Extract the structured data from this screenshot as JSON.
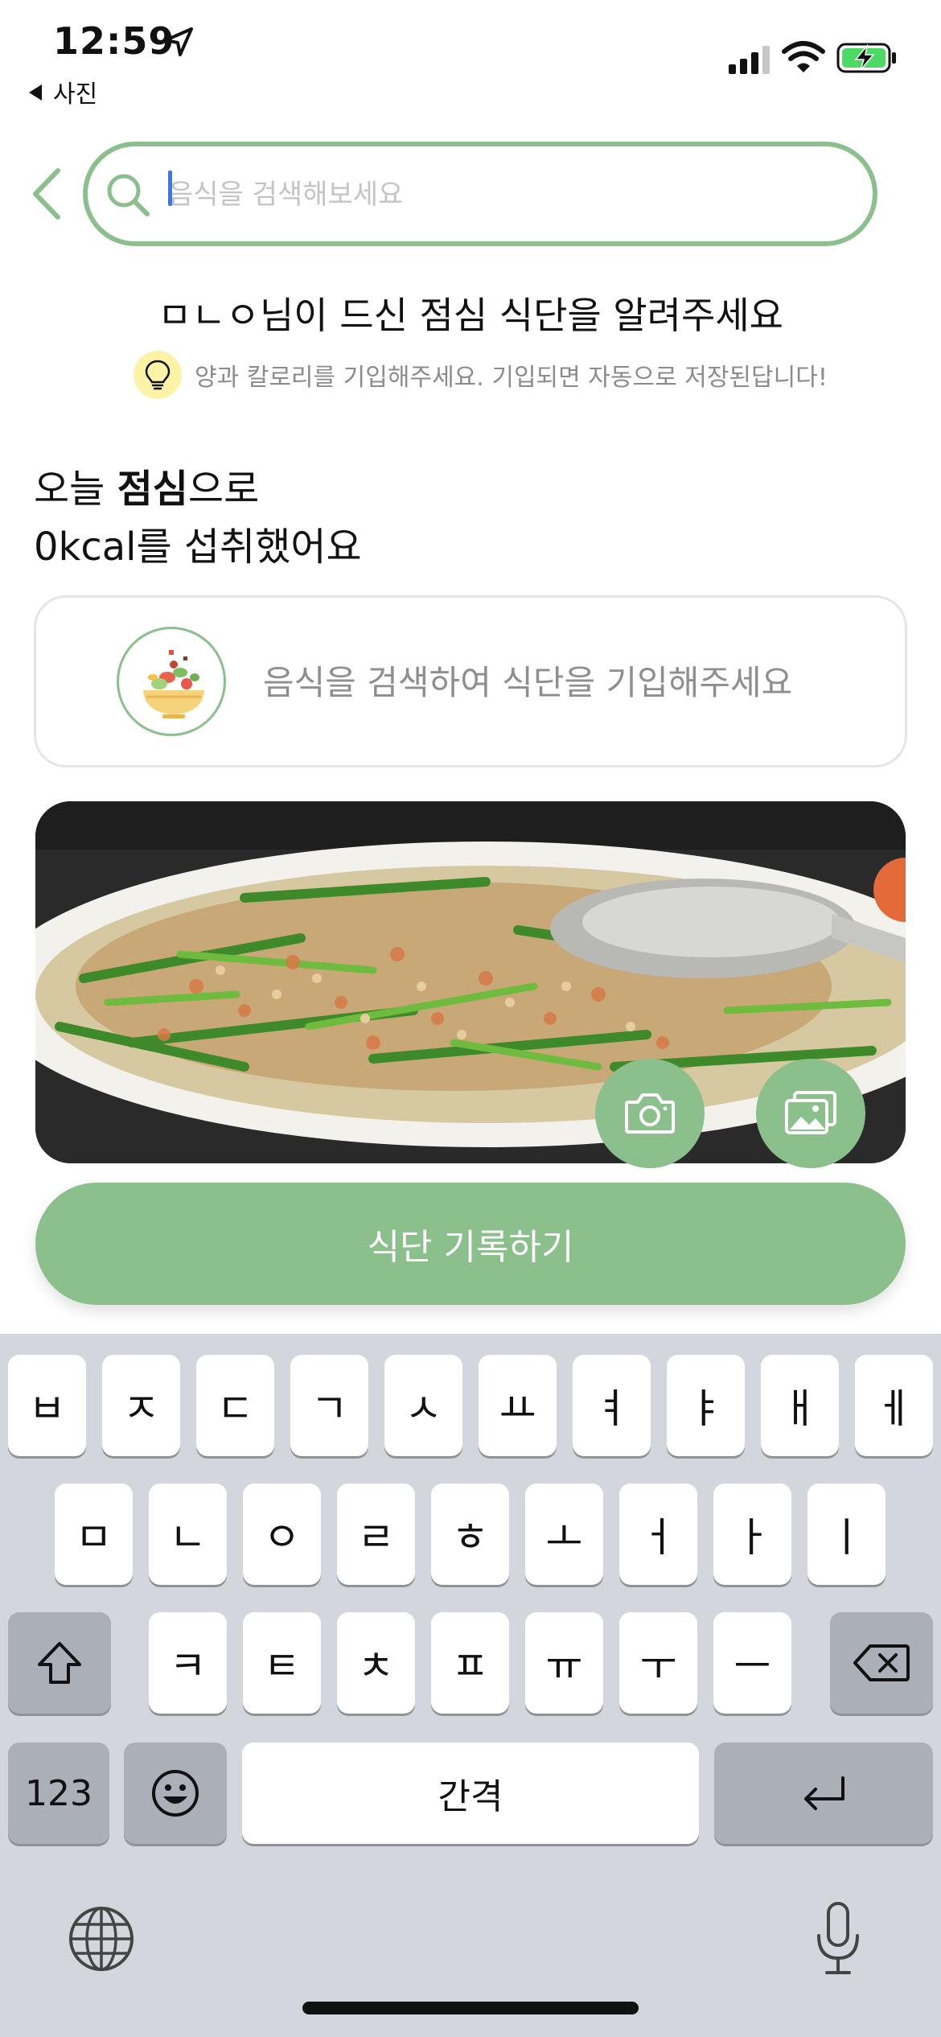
{
  "status_bar": {
    "time": "12:59",
    "back_app": "사진",
    "icons": [
      "location-arrow-icon",
      "signal-icon",
      "wifi-icon",
      "battery-charging-icon"
    ]
  },
  "search": {
    "placeholder": "음식을 검색해보세요",
    "value": ""
  },
  "heading": {
    "title": "ㅁㄴㅇ님이 드신 점심 식단을 알려주세요",
    "hint": "양과 칼로리를 기입해주세요. 기입되면 자동으로 저장된답니다!"
  },
  "summary": {
    "line1_prefix": "오늘 ",
    "meal": "점심",
    "line1_suffix": "으로",
    "calories": "0kcal",
    "line2_suffix": "를 섭취했어요"
  },
  "food_card": {
    "prompt": "음식을 검색하여 식단을 기입해주세요"
  },
  "photo": {
    "description_icon": "food-photo",
    "buttons": [
      "camera-icon",
      "gallery-icon"
    ]
  },
  "record_button": {
    "label": "식단 기록하기"
  },
  "keyboard": {
    "row1": [
      "ㅂ",
      "ㅈ",
      "ㄷ",
      "ㄱ",
      "ㅅ",
      "ㅛ",
      "ㅕ",
      "ㅑ",
      "ㅐ",
      "ㅔ"
    ],
    "row2": [
      "ㅁ",
      "ㄴ",
      "ㅇ",
      "ㄹ",
      "ㅎ",
      "ㅗ",
      "ㅓ",
      "ㅏ",
      "ㅣ"
    ],
    "row3": [
      "ㅋ",
      "ㅌ",
      "ㅊ",
      "ㅍ",
      "ㅠ",
      "ㅜ",
      "ㅡ"
    ],
    "numbers_key": "123",
    "space_key": "간격"
  },
  "colors": {
    "accent": "#8bbf8c",
    "hint_bulb_bg": "#fdf3a6",
    "keyboard_bg": "#d3d6dc"
  }
}
